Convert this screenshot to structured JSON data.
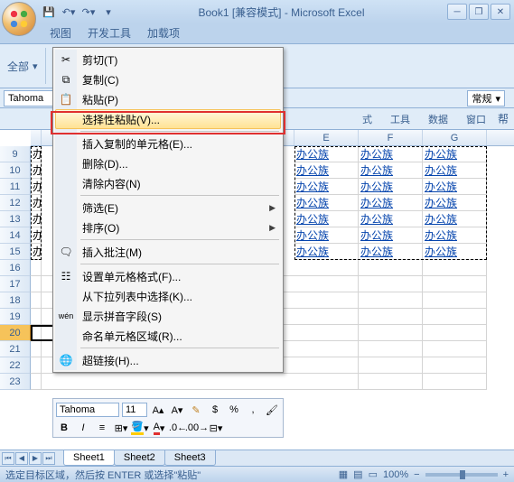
{
  "title": "Book1 [兼容模式] - Microsoft Excel",
  "qat": {
    "save": "save-icon",
    "undo": "undo-icon",
    "redo": "redo-icon"
  },
  "tabs": [
    "视图",
    "开发工具",
    "加载项"
  ],
  "ribbon": {
    "all": "全部",
    "groups": [
      "式",
      "工具",
      "数据",
      "窗口"
    ],
    "help": "帮"
  },
  "namebox": "Tahoma",
  "fmt": {
    "category": "常规"
  },
  "columns": [
    "E",
    "F",
    "G"
  ],
  "rows_head": [
    "9",
    "10",
    "11",
    "12",
    "13",
    "14",
    "15",
    "16",
    "17",
    "18",
    "19",
    "20",
    "21",
    "22",
    "23"
  ],
  "cell_link": "办公族",
  "left_cell": "办",
  "context_menu": {
    "cut": "剪切(T)",
    "copy": "复制(C)",
    "paste": "粘贴(P)",
    "paste_special": "选择性粘贴(V)...",
    "insert_copied": "插入复制的单元格(E)...",
    "delete": "删除(D)...",
    "clear": "清除内容(N)",
    "filter": "筛选(E)",
    "sort": "排序(O)",
    "insert_comment": "插入批注(M)",
    "format_cells": "设置单元格格式(F)...",
    "pick_list": "从下拉列表中选择(K)...",
    "phonetic": "显示拼音字段(S)",
    "name_range": "命名单元格区域(R)...",
    "hyperlink": "超链接(H)..."
  },
  "mini": {
    "font": "Tahoma",
    "size": "11",
    "bold": "B",
    "italic": "I"
  },
  "sheets": [
    "Sheet1",
    "Sheet2",
    "Sheet3"
  ],
  "status": "选定目标区域，然后按 ENTER 或选择\"粘贴\"",
  "zoom": "100%"
}
